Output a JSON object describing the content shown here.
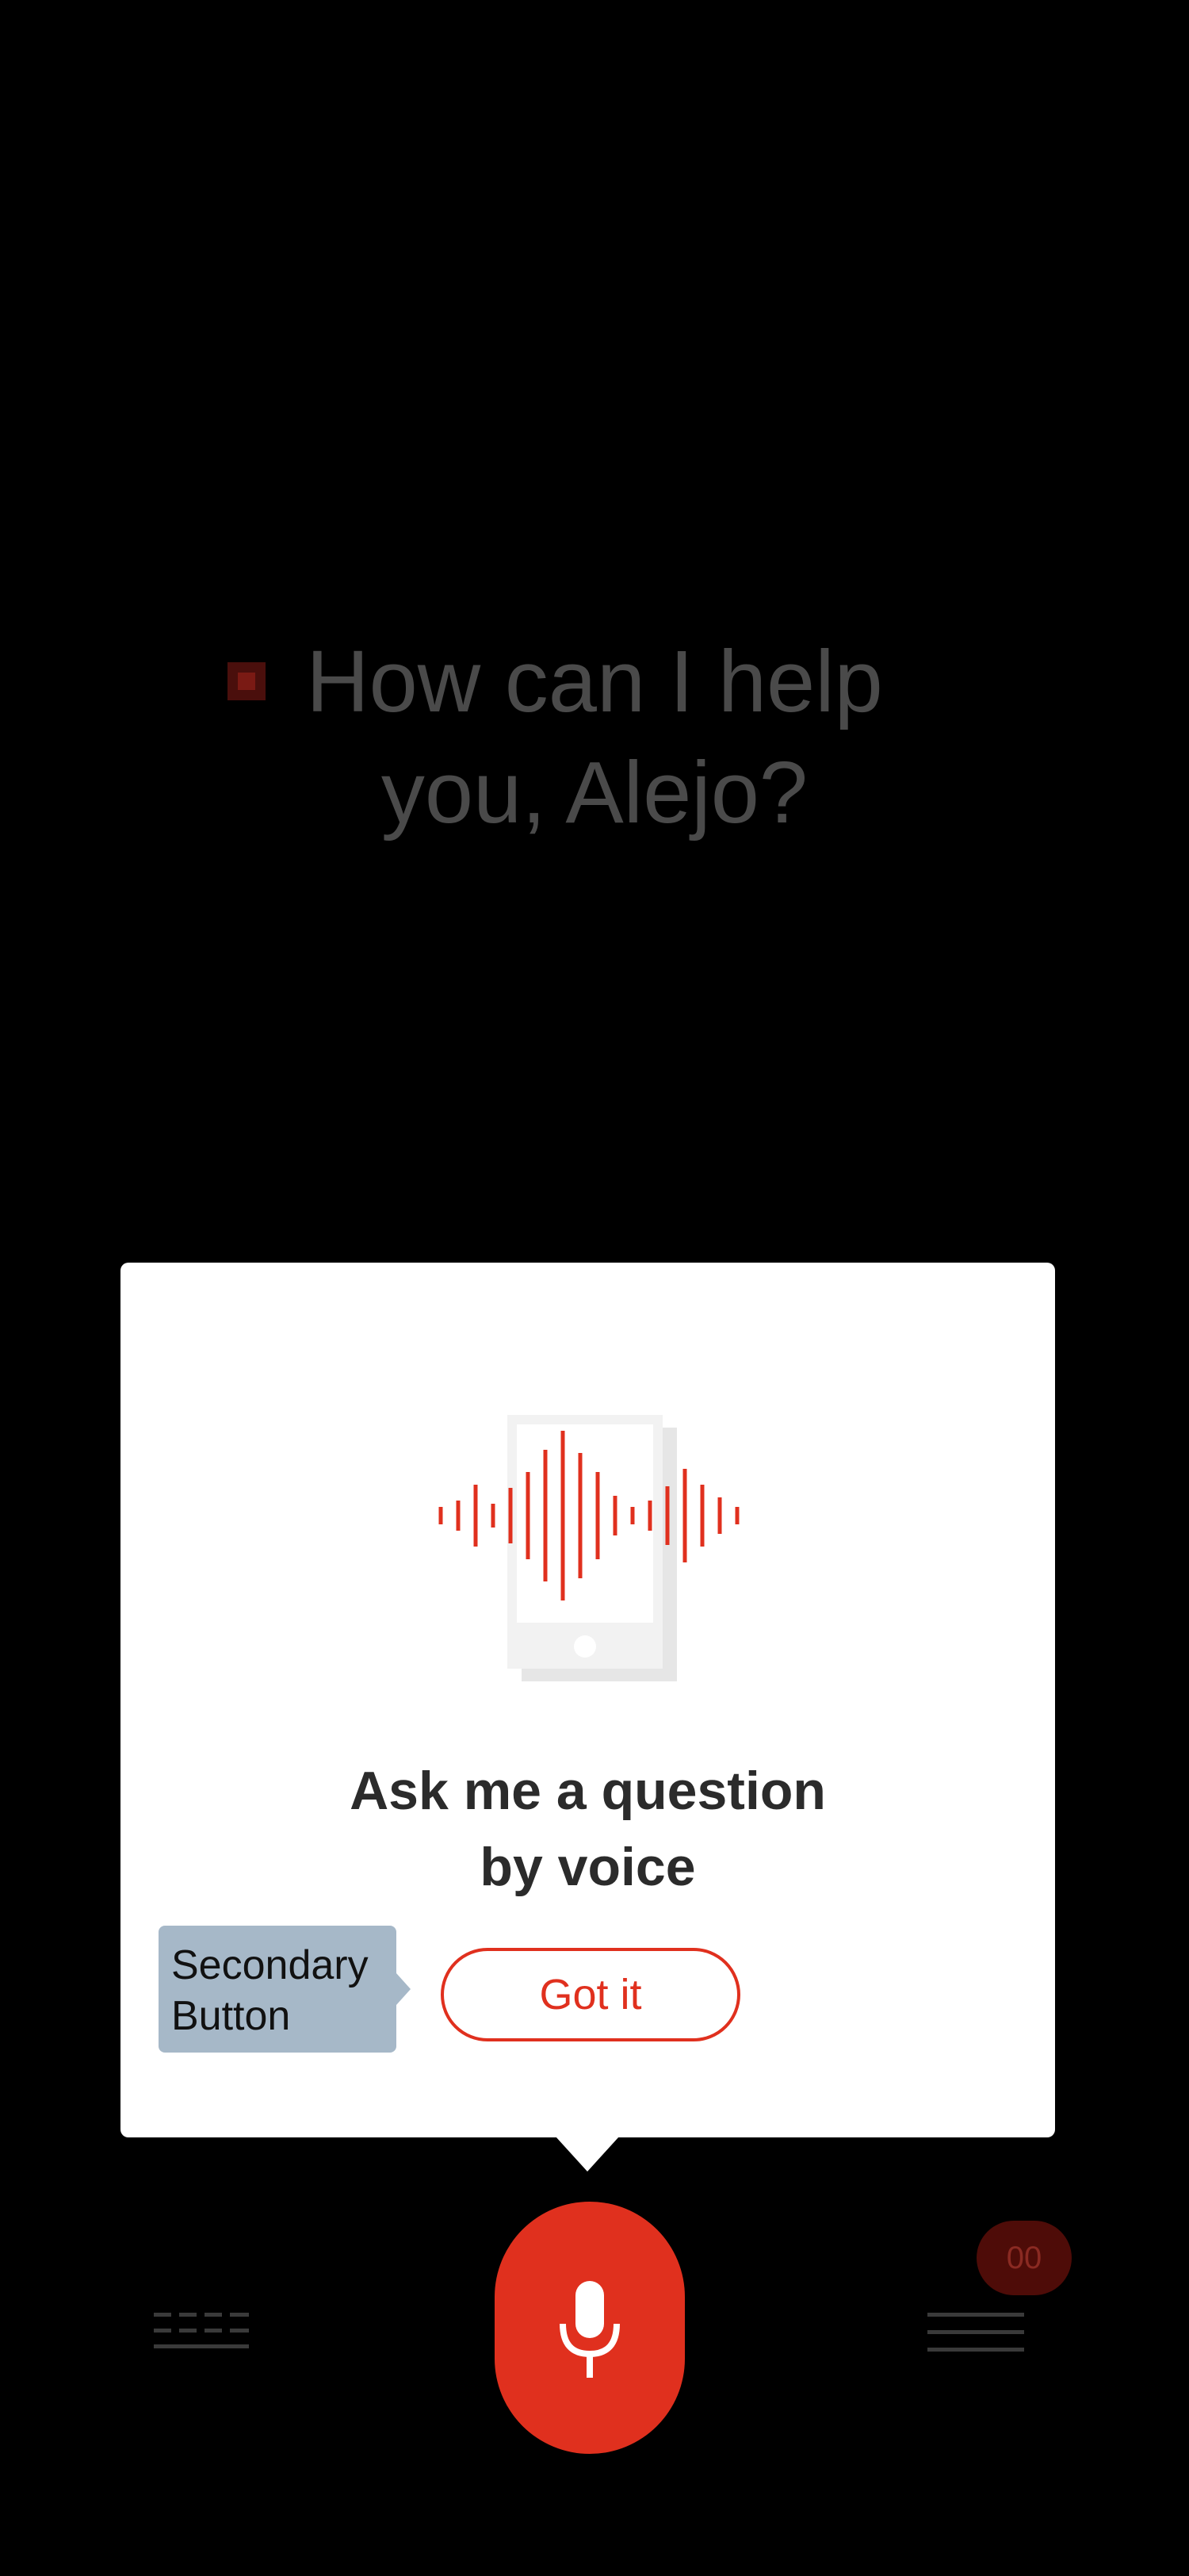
{
  "greeting": {
    "line1": "How can I help",
    "line2": "you, Alejo?"
  },
  "onboarding_modal": {
    "title_line1": "Ask me a question",
    "title_line2": "by voice",
    "illustration_icon": "phone-voice-waveform-icon",
    "primary_button_label": "Got it",
    "secondary_button_annotation_line1": "Secondary",
    "secondary_button_annotation_line2": "Button"
  },
  "bottom_bar": {
    "keyboard_icon": "keyboard-icon",
    "mic_icon": "microphone-icon",
    "menu_icon": "menu-icon",
    "badge_count": "00"
  },
  "colors": {
    "accent": "#e0301e",
    "background": "#000000",
    "modal_background": "#ffffff",
    "annotation_background": "#a6b8c8",
    "greeting_text": "#4a4a4a",
    "badge_background": "#4e0c08"
  }
}
